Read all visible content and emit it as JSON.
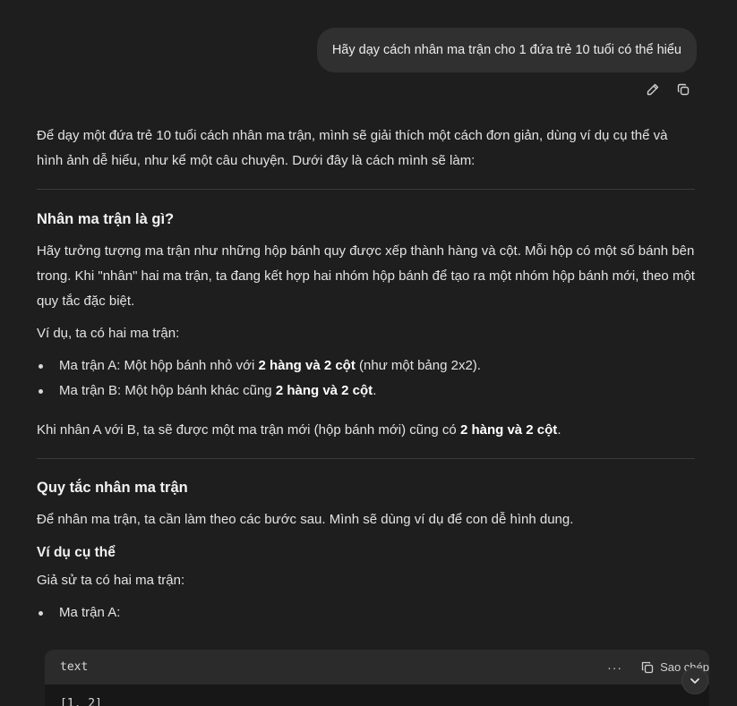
{
  "user_message": {
    "text": "Hãy dạy cách nhân ma trận cho 1 đứa trẻ 10 tuổi có thể hiểu",
    "actions": [
      "edit-icon",
      "copy-icon"
    ]
  },
  "answer": {
    "intro": "Để dạy một đứa trẻ 10 tuổi cách nhân ma trận, mình sẽ giải thích một cách đơn giản, dùng ví dụ cụ thể và hình ảnh dễ hiểu, như kể một câu chuyện. Dưới đây là cách mình sẽ làm:",
    "section1": {
      "heading": "Nhân ma trận là gì?",
      "para1": "Hãy tưởng tượng ma trận như những hộp bánh quy được xếp thành hàng và cột. Mỗi hộp có một số bánh bên trong. Khi \"nhân\" hai ma trận, ta đang kết hợp hai nhóm hộp bánh để tạo ra một nhóm hộp bánh mới, theo một quy tắc đặc biệt.",
      "para2": "Ví dụ, ta có hai ma trận:",
      "bullets": [
        {
          "prefix": "Ma trận A: Một hộp bánh nhỏ với ",
          "bold": "2 hàng và 2 cột",
          "suffix": " (như một bảng 2x2)."
        },
        {
          "prefix": "Ma trận B: Một hộp bánh khác cũng ",
          "bold": "2 hàng và 2 cột",
          "suffix": "."
        }
      ],
      "para3": {
        "prefix": "Khi nhân A với B, ta sẽ được một ma trận mới (hộp bánh mới) cũng có ",
        "bold": "2 hàng và 2 cột",
        "suffix": "."
      }
    },
    "section2": {
      "heading": "Quy tắc nhân ma trận",
      "para1": "Để nhân ma trận, ta cần làm theo các bước sau. Mình sẽ dùng ví dụ để con dễ hình dung.",
      "subheading": "Ví dụ cụ thể",
      "para2": "Giả sử ta có hai ma trận:",
      "bullets": [
        "Ma trận A:"
      ]
    }
  },
  "code_block": {
    "language": "text",
    "more_label": "···",
    "copy_label": "Sao chép",
    "first_line": "[1, 2]"
  },
  "colors": {
    "background": "#1e1e1f",
    "bubble": "#303030",
    "code_header": "#2b2b2b",
    "code_body": "#171717"
  }
}
